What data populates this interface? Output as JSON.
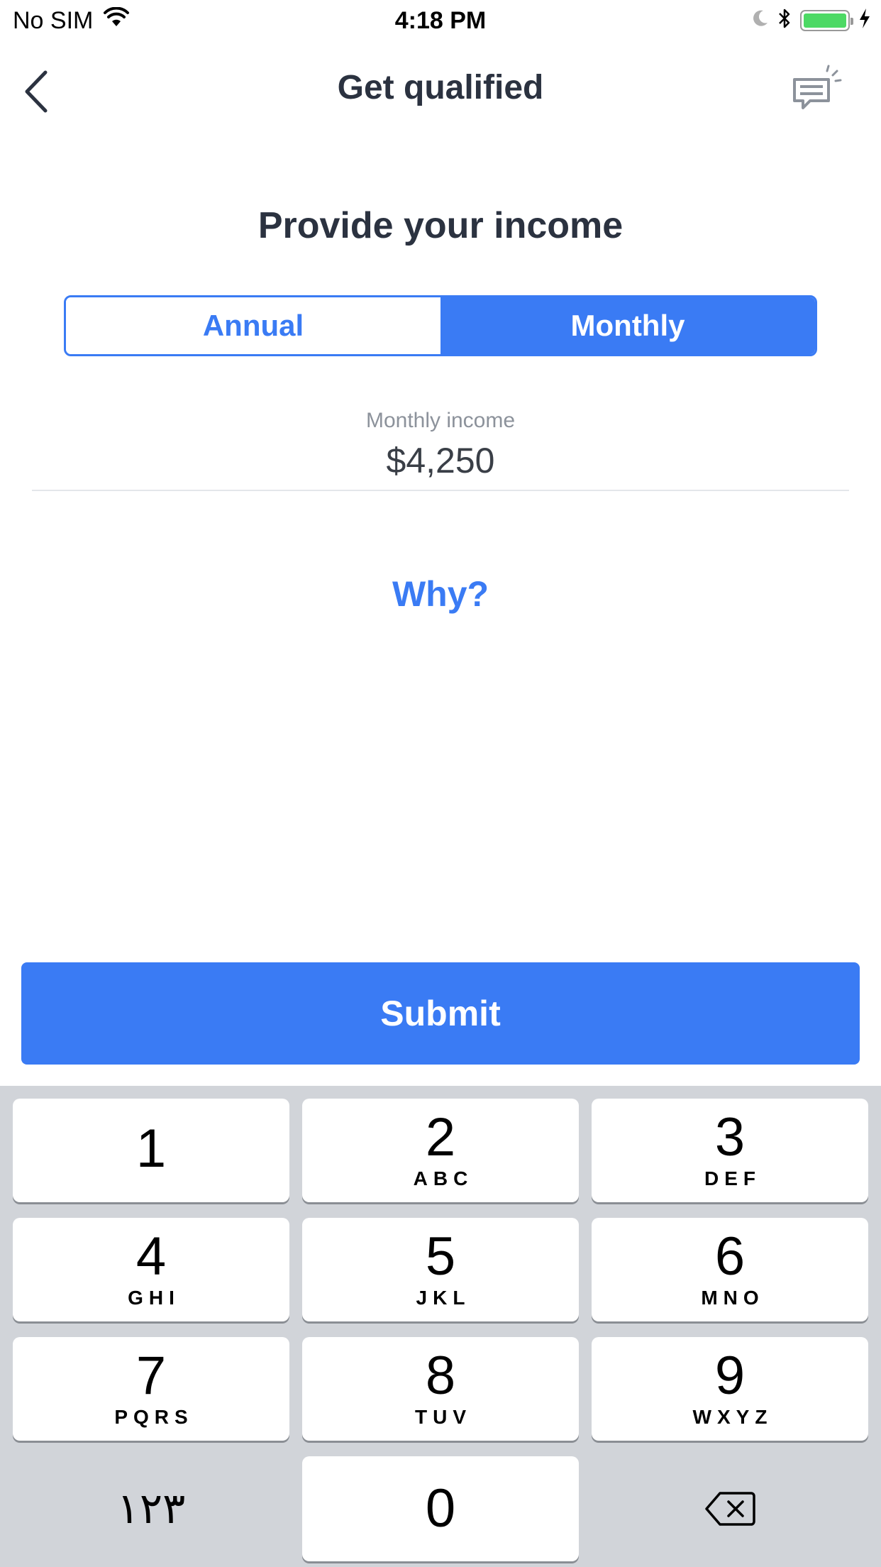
{
  "status_bar": {
    "carrier": "No SIM",
    "time": "4:18 PM"
  },
  "nav": {
    "title": "Get qualified"
  },
  "main": {
    "heading": "Provide your income",
    "segments": [
      {
        "label": "Annual",
        "selected": false
      },
      {
        "label": "Monthly",
        "selected": true
      }
    ],
    "income_field": {
      "label": "Monthly income",
      "value": "$4,250"
    },
    "why_link": "Why?",
    "submit_label": "Submit"
  },
  "keyboard": {
    "keys": [
      {
        "digit": "1",
        "letters": ""
      },
      {
        "digit": "2",
        "letters": "ABC"
      },
      {
        "digit": "3",
        "letters": "DEF"
      },
      {
        "digit": "4",
        "letters": "GHI"
      },
      {
        "digit": "5",
        "letters": "JKL"
      },
      {
        "digit": "6",
        "letters": "MNO"
      },
      {
        "digit": "7",
        "letters": "PQRS"
      },
      {
        "digit": "8",
        "letters": "TUV"
      },
      {
        "digit": "9",
        "letters": "WXYZ"
      },
      {
        "digit": "0",
        "letters": ""
      }
    ],
    "alt_key_label": "١٢٣"
  },
  "colors": {
    "accent": "#3a7bf4",
    "text_dark": "#2b3240",
    "label_gray": "#8c929b",
    "keyboard_bg": "#d1d4d9",
    "battery_green": "#4cd964"
  },
  "icons": {
    "back": "chevron-left-icon",
    "chat": "chat-bubble-icon",
    "wifi": "wifi-icon",
    "moon": "moon-icon",
    "bluetooth": "bluetooth-icon",
    "battery": "battery-icon",
    "charging": "charging-bolt-icon",
    "backspace": "backspace-icon"
  },
  "battery_level": 1.0
}
